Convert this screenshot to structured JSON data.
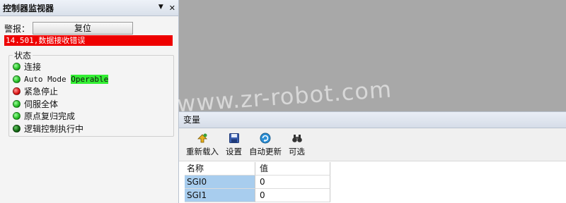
{
  "controller_panel": {
    "title": "控制器监视器",
    "pin_glyph": "▼",
    "close_glyph": "✕",
    "alarm_label": "警报：",
    "reset_label": "复位",
    "error_text": "14.501,数据接收错误",
    "status_title": "状态",
    "status_items": [
      {
        "label": "连接",
        "led": "#22bb22"
      },
      {
        "label": "Auto Mode ",
        "highlight": "Operable",
        "led": "#22bb22"
      },
      {
        "label": "紧急停止",
        "led": "#dd1111"
      },
      {
        "label": "伺服全体",
        "led": "#22bb22"
      },
      {
        "label": "原点复归完成",
        "led": "#22bb22"
      },
      {
        "label": "逻辑控制执行中",
        "led": "#116611"
      }
    ]
  },
  "watermark": "www.zr-robot.com",
  "variables_panel": {
    "title": "变量",
    "toolbar": [
      {
        "label": "重新载入",
        "icon": "reload-icon"
      },
      {
        "label": "设置",
        "icon": "save-icon"
      },
      {
        "label": "自动更新",
        "icon": "refresh-icon"
      },
      {
        "label": "可选",
        "icon": "binoculars-icon"
      }
    ],
    "columns": [
      "名称",
      "值"
    ],
    "rows": [
      {
        "name": "SGI0",
        "value": "0"
      },
      {
        "name": "SGI1",
        "value": "0"
      }
    ]
  },
  "colors": {
    "error_bar": "#ee0000",
    "highlight": "#33ee33",
    "selected_name": "#a8cdee"
  }
}
